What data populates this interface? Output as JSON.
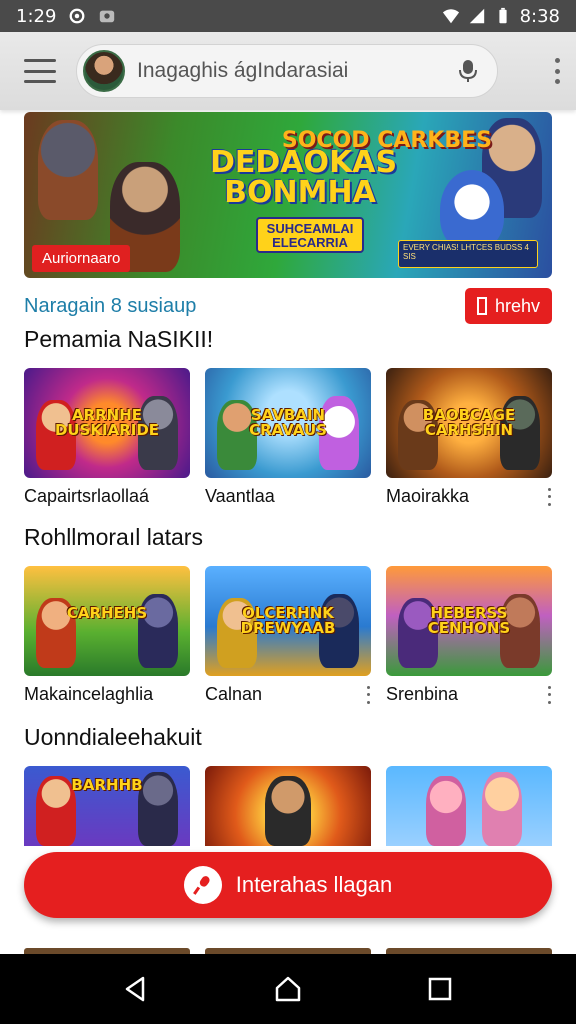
{
  "status_bar": {
    "time": "1:29",
    "clock_right": "8:38",
    "icons": [
      "location-icon",
      "photo-icon",
      "wifi-icon",
      "signal-icon",
      "battery-icon"
    ]
  },
  "app_bar": {
    "search_text": "Inagaghis ágIndarasiai",
    "icons": [
      "menu-icon",
      "avatar",
      "mic-icon",
      "more-icon"
    ]
  },
  "banner": {
    "title": "DEDAOKAS BONMHA",
    "subtitle": "SUHCEAMLAI ELECARRIA",
    "right_title": "SOCOD CARKBES",
    "panel_text": "EVERY CHIAS! LHTCES BUDSS 4 SIS",
    "badge": "Auriornaaro"
  },
  "meta": {
    "text": "Naragain 8  susiaup",
    "share_label": "hrehv"
  },
  "sections": [
    {
      "title": "Pemamia NaSIKII!",
      "items": [
        {
          "thumb_text": "ARRNHE DUSKIARIDE",
          "title": "Capairtsrlaollaá",
          "has_menu": false
        },
        {
          "thumb_text": "SAVBAIN CRAVAUS",
          "title": "Vaantlaa",
          "has_menu": false
        },
        {
          "thumb_text": "BAOBCAGE CARHSHIN",
          "title": "Maoirakka",
          "has_menu": true
        }
      ]
    },
    {
      "title": "Rohllmoraıl latars",
      "items": [
        {
          "thumb_text": "CARHEHS",
          "title": "Makaincelaghlia",
          "has_menu": false
        },
        {
          "thumb_text": "OLCERHNK DREWYAAB",
          "title": "Calnan",
          "has_menu": true
        },
        {
          "thumb_text": "HEBERSS CENHONS",
          "title": "Srenbina",
          "has_menu": true
        }
      ]
    },
    {
      "title": "Uonndialeehakuit",
      "items": [
        {
          "thumb_text": "BARHHB",
          "title": "",
          "has_menu": false
        },
        {
          "thumb_text": "",
          "title": "",
          "has_menu": false
        },
        {
          "thumb_text": "",
          "title": "",
          "has_menu": false
        }
      ]
    }
  ],
  "cta": {
    "label": "Interahas llagan"
  },
  "nav": {
    "icons": [
      "back-icon",
      "home-icon",
      "recents-icon"
    ]
  },
  "colors": {
    "accent_red": "#e51f1f",
    "link_blue": "#1e7ea8",
    "status_bar": "#4a4a4a",
    "nav_bar": "#000000"
  }
}
